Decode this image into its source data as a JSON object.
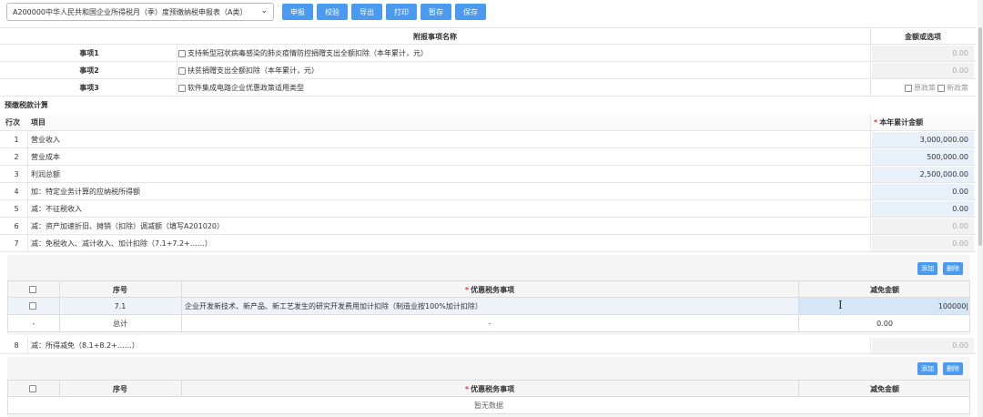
{
  "toolbar": {
    "form_select": "A200000中华人民共和国企业所得税月（季）度预缴纳税申报表（A类）",
    "buttons": [
      "申报",
      "校验",
      "导出",
      "打印",
      "暂存",
      "保存"
    ]
  },
  "attach": {
    "header_name": "附报事项名称",
    "header_value": "金额或选项",
    "items": [
      {
        "label": "事项1",
        "text": "支持新型冠状病毒感染的肺炎疫情防控捐赠支出全额扣除（本年累计，元）",
        "value": "0.00"
      },
      {
        "label": "事项2",
        "text": "扶贫捐赠支出全额扣除（本年累计，元）",
        "value": "0.00"
      },
      {
        "label": "事项3",
        "text": "软件集成电路企业优惠政策适用类型",
        "opt1": "原政策",
        "opt2": "新政策"
      }
    ]
  },
  "calc": {
    "section_title": "预缴税款计算",
    "col_no": "行次",
    "col_item": "项目",
    "col_amount": "本年累计金额",
    "required_mark": "*",
    "rows": [
      {
        "no": "1",
        "item": "营业收入",
        "amount": "3,000,000.00"
      },
      {
        "no": "2",
        "item": "营业成本",
        "amount": "500,000.00"
      },
      {
        "no": "3",
        "item": "利润总额",
        "amount": "2,500,000.00"
      },
      {
        "no": "4",
        "item": "加：特定业务计算的应纳税所得额",
        "amount": "0.00"
      },
      {
        "no": "5",
        "item": "减：不征税收入",
        "amount": "0.00"
      },
      {
        "no": "6",
        "item": "减：资产加速折旧、摊销（扣除）调减额（填写A201020）",
        "amount": "0.00"
      },
      {
        "no": "7",
        "item": "减：免税收入、减计收入、加计扣除（7.1+7.2+……）",
        "amount": "0.00"
      }
    ],
    "row8": {
      "no": "8",
      "item": "减：所得减免（8.1+8.2+……）",
      "amount": "0.00"
    }
  },
  "sub1": {
    "add": "添加",
    "delete": "删除",
    "col_seq": "序号",
    "col_item": "优惠税务事项",
    "col_amount": "减免金额",
    "rows": [
      {
        "seq": "7.1",
        "item": "企业开发新技术、新产品、新工艺发生的研究开发费用加计扣除（制造业按100%加计扣除）",
        "amount": "100000"
      }
    ],
    "total": {
      "mark": "-",
      "seq": "总计",
      "item": "-",
      "amount": "0.00"
    }
  },
  "sub2": {
    "add": "添加",
    "delete": "删除",
    "col_seq": "序号",
    "col_item": "优惠税务事项",
    "col_amount": "减免金额",
    "empty": "暂无数据"
  },
  "colors": {
    "accent": "#4a9bef",
    "input_blue": "#e8f0fa",
    "input_grey": "#f2f2f2"
  }
}
